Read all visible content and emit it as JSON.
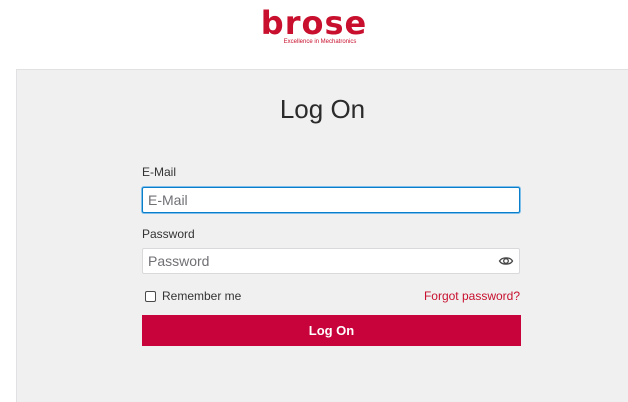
{
  "brand": {
    "name": "brose",
    "tagline": "Excellence in Mechatronics",
    "color": "#c8102e"
  },
  "form": {
    "title": "Log On",
    "email_label": "E-Mail",
    "email_placeholder": "E-Mail",
    "email_value": "",
    "password_label": "Password",
    "password_placeholder": "Password",
    "password_value": "",
    "password_toggle_icon": "eye-icon",
    "remember_label": "Remember me",
    "remember_checked": false,
    "forgot_label": "Forgot password?",
    "submit_label": "Log On",
    "submit_color": "#c8023b"
  }
}
